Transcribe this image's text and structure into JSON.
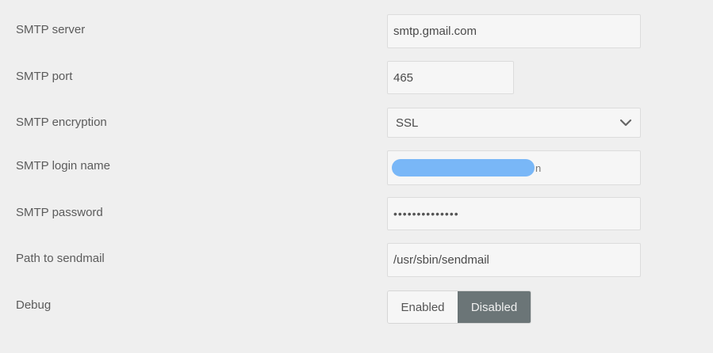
{
  "fields": {
    "smtp_server": {
      "label": "SMTP server",
      "value": "smtp.gmail.com"
    },
    "smtp_port": {
      "label": "SMTP port",
      "value": "465"
    },
    "smtp_encryption": {
      "label": "SMTP encryption",
      "value": "SSL"
    },
    "smtp_login": {
      "label": "SMTP login name",
      "value_suffix": "n"
    },
    "smtp_password": {
      "label": "SMTP password",
      "value": "••••••••••••••"
    },
    "sendmail_path": {
      "label": "Path to sendmail",
      "value": "/usr/sbin/sendmail"
    },
    "debug": {
      "label": "Debug",
      "options": [
        "Enabled",
        "Disabled"
      ],
      "selected": "Disabled"
    }
  },
  "colors": {
    "background": "#efefef",
    "field_bg": "#f6f6f6",
    "toggle_active": "#6b7577",
    "redaction": "#79b7f7"
  }
}
